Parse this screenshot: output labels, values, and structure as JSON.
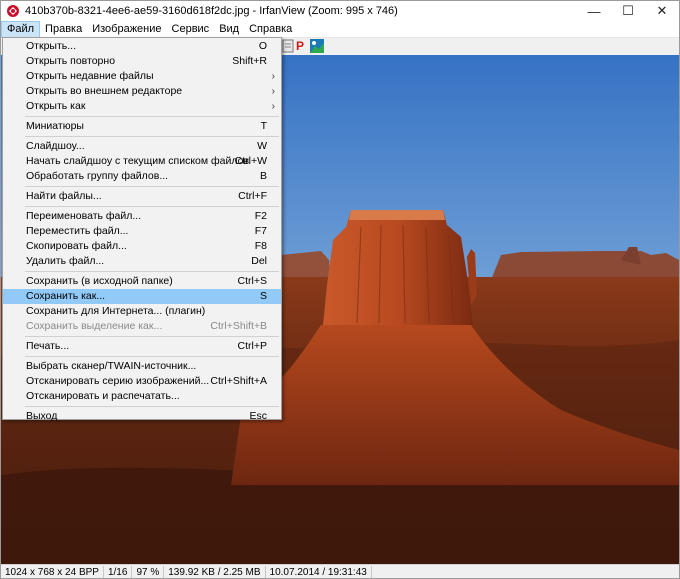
{
  "window": {
    "title": "410b370b-8321-4ee6-ae59-3160d618f2dc.jpg - IrfanView (Zoom: 995 x 746)",
    "controls": {
      "minimize": "—",
      "maximize": "☐",
      "close": "✕"
    }
  },
  "menubar": [
    "Файл",
    "Правка",
    "Изображение",
    "Сервис",
    "Вид",
    "Справка"
  ],
  "file_menu": {
    "groups": [
      [
        {
          "label": "Открыть...",
          "shortcut": "O"
        },
        {
          "label": "Открыть повторно",
          "shortcut": "Shift+R"
        },
        {
          "label": "Открыть недавние файлы",
          "submenu": "›"
        },
        {
          "label": "Открыть во внешнем редакторе",
          "submenu": "›"
        },
        {
          "label": "Открыть как",
          "submenu": "›"
        }
      ],
      [
        {
          "label": "Миниатюры",
          "shortcut": "T"
        }
      ],
      [
        {
          "label": "Слайдшоу...",
          "shortcut": "W"
        },
        {
          "label": "Начать слайдшоу с текущим списком файлов",
          "shortcut": "Ctrl+W"
        },
        {
          "label": "Обработать группу файлов...",
          "shortcut": "B"
        }
      ],
      [
        {
          "label": "Найти файлы...",
          "shortcut": "Ctrl+F"
        }
      ],
      [
        {
          "label": "Переименовать файл...",
          "shortcut": "F2"
        },
        {
          "label": "Переместить файл...",
          "shortcut": "F7"
        },
        {
          "label": "Скопировать файл...",
          "shortcut": "F8"
        },
        {
          "label": "Удалить файл...",
          "shortcut": "Del"
        }
      ],
      [
        {
          "label": "Сохранить (в исходной папке)",
          "shortcut": "Ctrl+S"
        },
        {
          "label": "Сохранить как...",
          "shortcut": "S",
          "highlighted": true
        },
        {
          "label": "Сохранить для Интернета... (плагин)",
          "shortcut": ""
        },
        {
          "label": "Сохранить выделение как...",
          "shortcut": "Ctrl+Shift+B",
          "disabled": true
        }
      ],
      [
        {
          "label": "Печать...",
          "shortcut": "Ctrl+P"
        }
      ],
      [
        {
          "label": "Выбрать сканер/TWAIN-источник...",
          "shortcut": ""
        },
        {
          "label": "Отсканировать серию изображений...",
          "shortcut": "Ctrl+Shift+A"
        },
        {
          "label": "Отсканировать и распечатать...",
          "shortcut": ""
        }
      ],
      [
        {
          "label": "Выход",
          "shortcut": "Esc"
        }
      ]
    ]
  },
  "toolbar_icons": [
    "gray-square-icon",
    "red-p-icon",
    "irfan-logo-icon"
  ],
  "toolbar_glyphs": {
    "p": "P"
  },
  "statusbar": [
    "1024 x 768 x 24 BPP",
    "1/16",
    "97 %",
    "139.92 KB / 2.25 MB",
    "10.07.2014 / 19:31:43"
  ],
  "colors": {
    "menu_highlight": "#91c9f7",
    "active_menu": "#cce4f7",
    "sky_top": "#3f7ac9",
    "rock": "#b2471d"
  }
}
